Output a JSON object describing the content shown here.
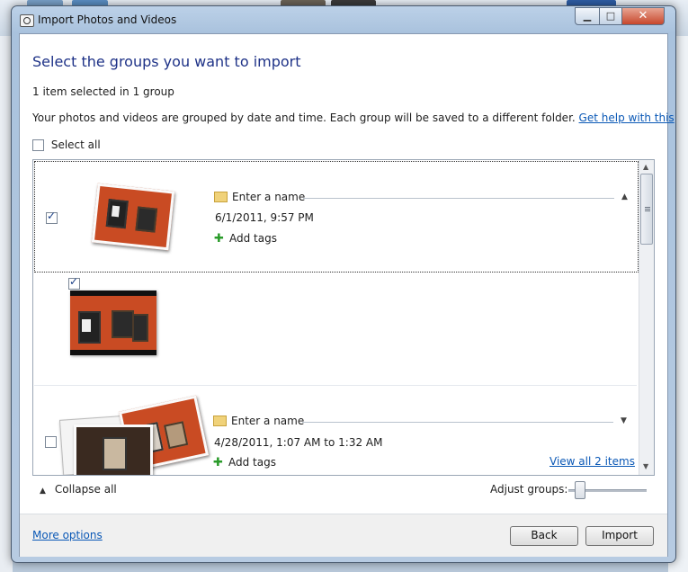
{
  "window": {
    "title": "Import Photos and Videos",
    "minimize_glyph": "▁",
    "maximize_glyph": "□",
    "close_glyph": "✕"
  },
  "page": {
    "heading": "Select the groups you want to import",
    "selection_summary": "1 item selected in 1 group",
    "description": "Your photos and videos are grouped by date and time. Each group will be saved to a different folder.",
    "help_link": "Get help with this",
    "select_all_label": "Select all",
    "select_all_checked": false
  },
  "groups": [
    {
      "checked": true,
      "name_placeholder": "Enter a name",
      "date": "6/1/2011, 9:57 PM",
      "tags_label": "Add tags",
      "expanded": true,
      "item_checked": true
    },
    {
      "checked": false,
      "name_placeholder": "Enter a name",
      "date": "4/28/2011, 1:07 AM to 1:32 AM",
      "tags_label": "Add tags",
      "expanded": false,
      "view_all_label": "View all 2 items"
    }
  ],
  "controls": {
    "collapse_all_label": "Collapse all",
    "adjust_groups_label": "Adjust groups:"
  },
  "footer": {
    "more_options_label": "More options",
    "back_label": "Back",
    "import_label": "Import"
  },
  "icons": {
    "folder": "folder-icon",
    "tag": "add-tag-icon",
    "collapse": "chevron-up-icon",
    "expand": "chevron-down-icon"
  },
  "colors": {
    "heading": "#1e3287",
    "link": "#0a58b6",
    "photo_wall": "#c94b23"
  }
}
